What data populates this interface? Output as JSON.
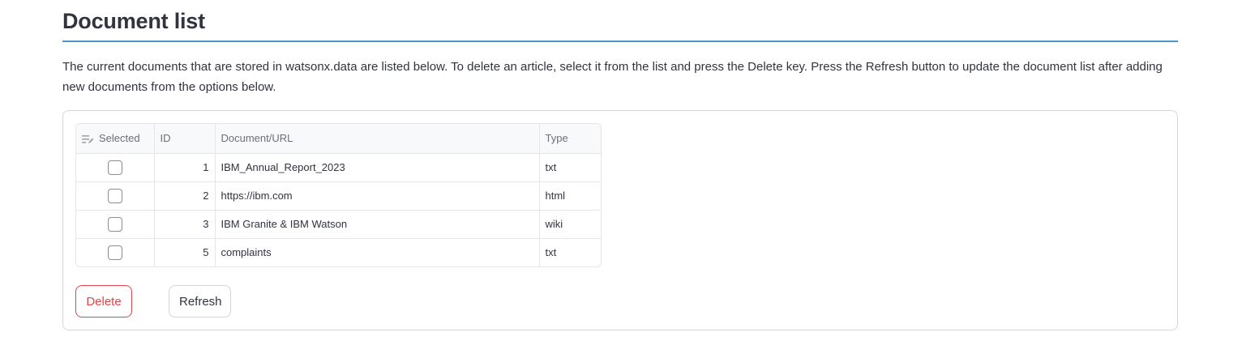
{
  "heading": "Document list",
  "description": "The current documents that are stored in watsonx.data are listed below. To delete an article, select it from the list and press the Delete key. Press the Refresh button to update the document list after adding new documents from the options below.",
  "table": {
    "columns": [
      "Selected",
      "ID",
      "Document/URL",
      "Type"
    ],
    "rows": [
      {
        "selected": false,
        "id": "1",
        "document": "IBM_Annual_Report_2023",
        "type": "txt"
      },
      {
        "selected": false,
        "id": "2",
        "document": "https://ibm.com",
        "type": "html"
      },
      {
        "selected": false,
        "id": "3",
        "document": "IBM Granite & IBM Watson",
        "type": "wiki"
      },
      {
        "selected": false,
        "id": "5",
        "document": "complaints",
        "type": "txt"
      }
    ]
  },
  "buttons": {
    "delete_label": "Delete",
    "refresh_label": "Refresh"
  },
  "colors": {
    "accent_line": "#4a98c9",
    "delete": "#e0454a",
    "text": "#31333f"
  },
  "icons": {
    "selected_column": "edit-list-icon"
  }
}
